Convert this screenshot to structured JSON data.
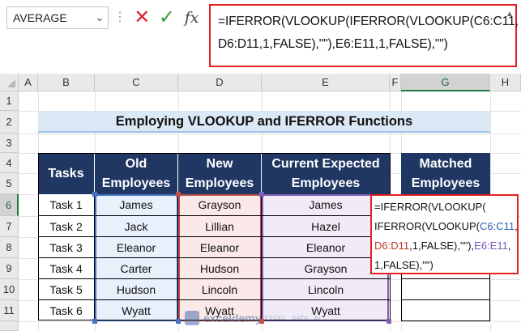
{
  "name_box": {
    "value": "AVERAGE"
  },
  "formula_bar": {
    "line1": "=IFERROR(VLOOKUP(IFERROR(VLOOKUP(C6:C11,",
    "line2": "D6:D11,1,FALSE),\"\"),E6:E11,1,FALSE),\"\")"
  },
  "columns": [
    "A",
    "B",
    "C",
    "D",
    "E",
    "F",
    "G",
    "H"
  ],
  "rows": [
    "1",
    "2",
    "3",
    "4",
    "5",
    "6",
    "7",
    "8",
    "9",
    "10",
    "11"
  ],
  "selected_column": "G",
  "selected_row": "6",
  "title": "Employing VLOOKUP and IFERROR Functions",
  "table": {
    "headers": {
      "tasks": "Tasks",
      "old": [
        "Old",
        "Employees"
      ],
      "new": [
        "New",
        "Employees"
      ],
      "current": [
        "Current Expected",
        "Employees"
      ]
    },
    "rows": [
      {
        "task": "Task 1",
        "old": "James",
        "new": "Grayson",
        "current": "James"
      },
      {
        "task": "Task 2",
        "old": "Jack",
        "new": "Lillian",
        "current": "Hazel"
      },
      {
        "task": "Task 3",
        "old": "Eleanor",
        "new": "Eleanor",
        "current": "Eleanor"
      },
      {
        "task": "Task 4",
        "old": "Carter",
        "new": "Hudson",
        "current": "Grayson"
      },
      {
        "task": "Task 5",
        "old": "Hudson",
        "new": "Lincoln",
        "current": "Lincoln"
      },
      {
        "task": "Task 6",
        "old": "Wyatt",
        "new": "Wyatt",
        "current": "Wyatt"
      }
    ]
  },
  "matched": {
    "header": [
      "Matched",
      "Employees"
    ],
    "edit": {
      "l1": "=IFERROR(VLOOKUP(",
      "l2a": "IFERROR(VLOOKUP(",
      "l2b": "C6:C11",
      "l2c": ",",
      "l3a": "D6:D11",
      "l3b": ",1,FALSE),\"\"),",
      "l3c": "E6:E11",
      "l3d": ",",
      "l4": "1,FALSE),\"\")"
    }
  },
  "watermark": {
    "name": "exceldemy",
    "tag": "EXCEL · DATA · BI"
  },
  "colors": {
    "header_fill": "#203764",
    "title_fill": "#dbe8f5",
    "highlight": "#e5201e",
    "range_c": "#4472c4",
    "range_d": "#c0504d",
    "range_e": "#7f5fb8"
  }
}
